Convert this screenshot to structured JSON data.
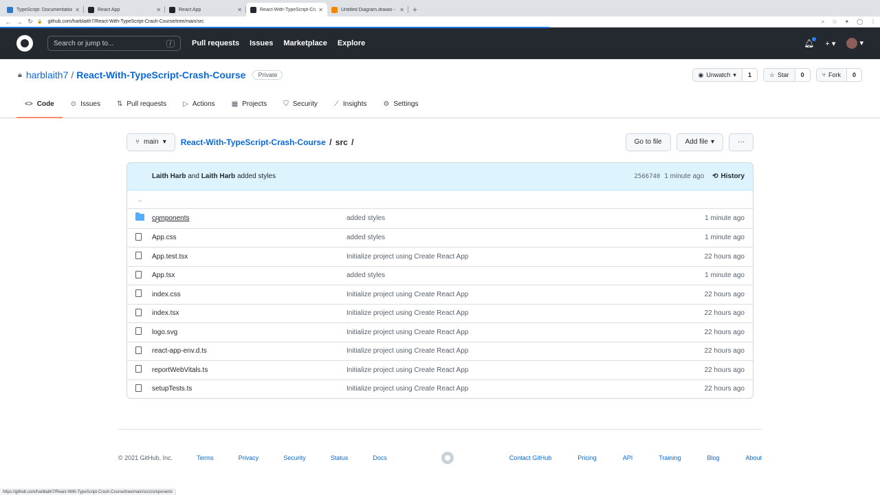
{
  "browser": {
    "tabs": [
      {
        "title": "TypeScript: Documentation - R",
        "color": "#3178c6",
        "active": false
      },
      {
        "title": "React App",
        "color": "#20232a",
        "active": false
      },
      {
        "title": "React App",
        "color": "#20232a",
        "active": false
      },
      {
        "title": "React-With-TypeScript-Crash-",
        "color": "#24292f",
        "active": true
      },
      {
        "title": "Untitled Diagram.drawio - diag",
        "color": "#f08705",
        "active": false
      }
    ],
    "url": "github.com/harblaith7/React-With-TypeScript-Crash-Course/tree/main/src",
    "status_url": "https://github.com/harblaith7/React-With-TypeScript-Crash-Course/tree/main/src/components"
  },
  "header": {
    "search_placeholder": "Search or jump to...",
    "search_key": "/",
    "nav": [
      "Pull requests",
      "Issues",
      "Marketplace",
      "Explore"
    ]
  },
  "repo": {
    "owner": "harblaith7",
    "name": "React-With-TypeScript-Crash-Course",
    "visibility": "Private",
    "unwatch_label": "Unwatch",
    "watch_count": "1",
    "star_label": "Star",
    "star_count": "0",
    "fork_label": "Fork",
    "fork_count": "0"
  },
  "repo_nav": [
    {
      "label": "Code",
      "icon": "code-icon",
      "glyph": "<>",
      "active": true
    },
    {
      "label": "Issues",
      "icon": "issue-icon",
      "glyph": "⊙",
      "active": false
    },
    {
      "label": "Pull requests",
      "icon": "pull-request-icon",
      "glyph": "⇅",
      "active": false
    },
    {
      "label": "Actions",
      "icon": "play-icon",
      "glyph": "▷",
      "active": false
    },
    {
      "label": "Projects",
      "icon": "project-icon",
      "glyph": "▦",
      "active": false
    },
    {
      "label": "Security",
      "icon": "shield-icon",
      "glyph": "⛉",
      "active": false
    },
    {
      "label": "Insights",
      "icon": "graph-icon",
      "glyph": "⟋",
      "active": false
    },
    {
      "label": "Settings",
      "icon": "gear-icon",
      "glyph": "⚙",
      "active": false
    }
  ],
  "toolbar": {
    "branch": "main",
    "breadcrumb_repo": "React-With-TypeScript-Crash-Course",
    "breadcrumb_dir": "src",
    "go_to_file": "Go to file",
    "add_file": "Add file"
  },
  "commit": {
    "author1": "Laith Harb",
    "and": "and",
    "author2": "Laith Harb",
    "message": "added styles",
    "sha": "2566740",
    "time": "1 minute ago",
    "history": "History"
  },
  "parent_dir": "..",
  "files": [
    {
      "name": "components",
      "type": "dir",
      "message": "added styles",
      "age": "1 minute ago"
    },
    {
      "name": "App.css",
      "type": "file",
      "message": "added styles",
      "age": "1 minute ago"
    },
    {
      "name": "App.test.tsx",
      "type": "file",
      "message": "Initialize project using Create React App",
      "age": "22 hours ago"
    },
    {
      "name": "App.tsx",
      "type": "file",
      "message": "added styles",
      "age": "1 minute ago"
    },
    {
      "name": "index.css",
      "type": "file",
      "message": "Initialize project using Create React App",
      "age": "22 hours ago"
    },
    {
      "name": "index.tsx",
      "type": "file",
      "message": "Initialize project using Create React App",
      "age": "22 hours ago"
    },
    {
      "name": "logo.svg",
      "type": "file",
      "message": "Initialize project using Create React App",
      "age": "22 hours ago"
    },
    {
      "name": "react-app-env.d.ts",
      "type": "file",
      "message": "Initialize project using Create React App",
      "age": "22 hours ago"
    },
    {
      "name": "reportWebVitals.ts",
      "type": "file",
      "message": "Initialize project using Create React App",
      "age": "22 hours ago"
    },
    {
      "name": "setupTests.ts",
      "type": "file",
      "message": "Initialize project using Create React App",
      "age": "22 hours ago"
    }
  ],
  "footer": {
    "copyright": "© 2021 GitHub, Inc.",
    "left_links": [
      "Terms",
      "Privacy",
      "Security",
      "Status",
      "Docs"
    ],
    "right_links": [
      "Contact GitHub",
      "Pricing",
      "API",
      "Training",
      "Blog",
      "About"
    ]
  }
}
